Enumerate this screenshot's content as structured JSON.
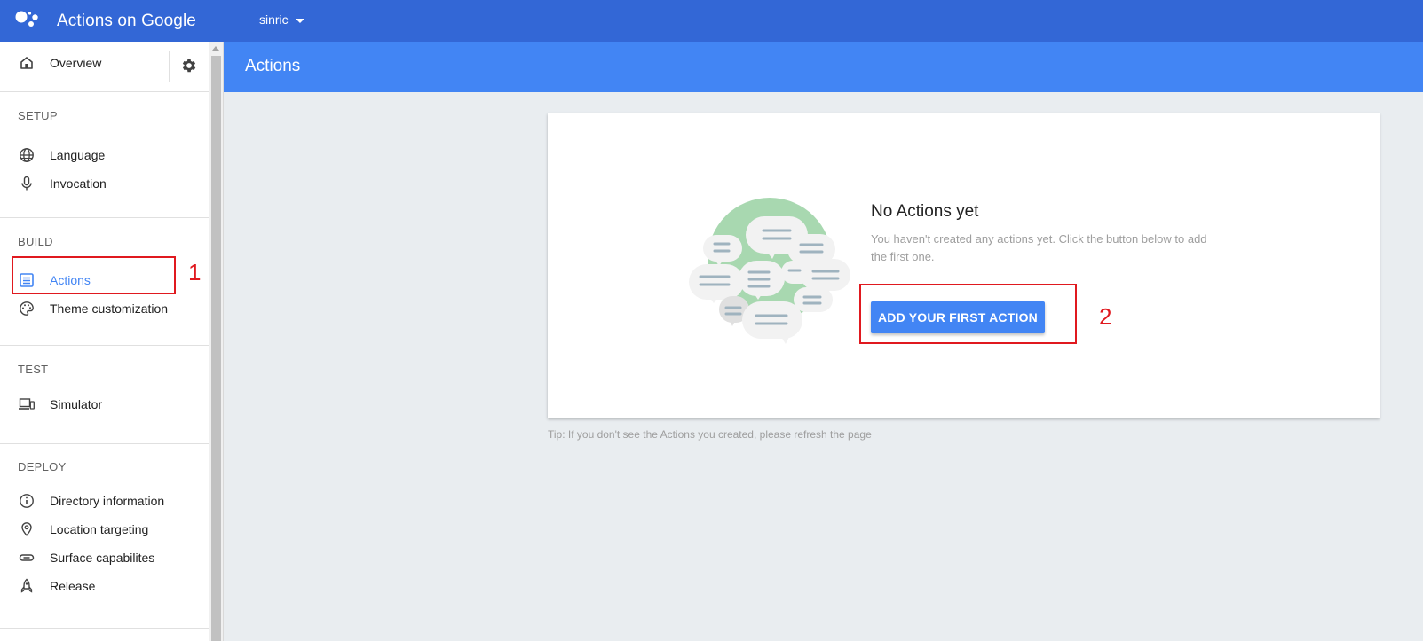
{
  "topbar": {
    "title": "Actions on Google",
    "project": "sinric"
  },
  "sidebar": {
    "overview": "Overview",
    "sections": [
      {
        "title": "SETUP",
        "items": [
          {
            "label": "Language",
            "icon": "globe-icon"
          },
          {
            "label": "Invocation",
            "icon": "microphone-icon"
          }
        ]
      },
      {
        "title": "BUILD",
        "items": [
          {
            "label": "Actions",
            "icon": "list-icon",
            "active": true
          },
          {
            "label": "Theme customization",
            "icon": "palette-icon"
          }
        ]
      },
      {
        "title": "TEST",
        "items": [
          {
            "label": "Simulator",
            "icon": "devices-icon"
          }
        ]
      },
      {
        "title": "DEPLOY",
        "items": [
          {
            "label": "Directory information",
            "icon": "info-icon"
          },
          {
            "label": "Location targeting",
            "icon": "location-pin-icon"
          },
          {
            "label": "Surface capabilites",
            "icon": "link-icon"
          },
          {
            "label": "Release",
            "icon": "rocket-icon"
          }
        ]
      }
    ]
  },
  "main": {
    "header_title": "Actions",
    "empty_title": "No Actions yet",
    "empty_desc": "You haven't created any actions yet. Click the button below to add the first one.",
    "add_button": "ADD YOUR FIRST ACTION",
    "tip": "Tip: If you don't see the Actions you created, please refresh the page"
  },
  "annotations": {
    "marker_1": "1",
    "marker_2": "2",
    "color": "#e0191f"
  },
  "colors": {
    "topbar": "#3367d6",
    "header": "#4285f4",
    "accent": "#4285f4",
    "background": "#e9edf0"
  }
}
